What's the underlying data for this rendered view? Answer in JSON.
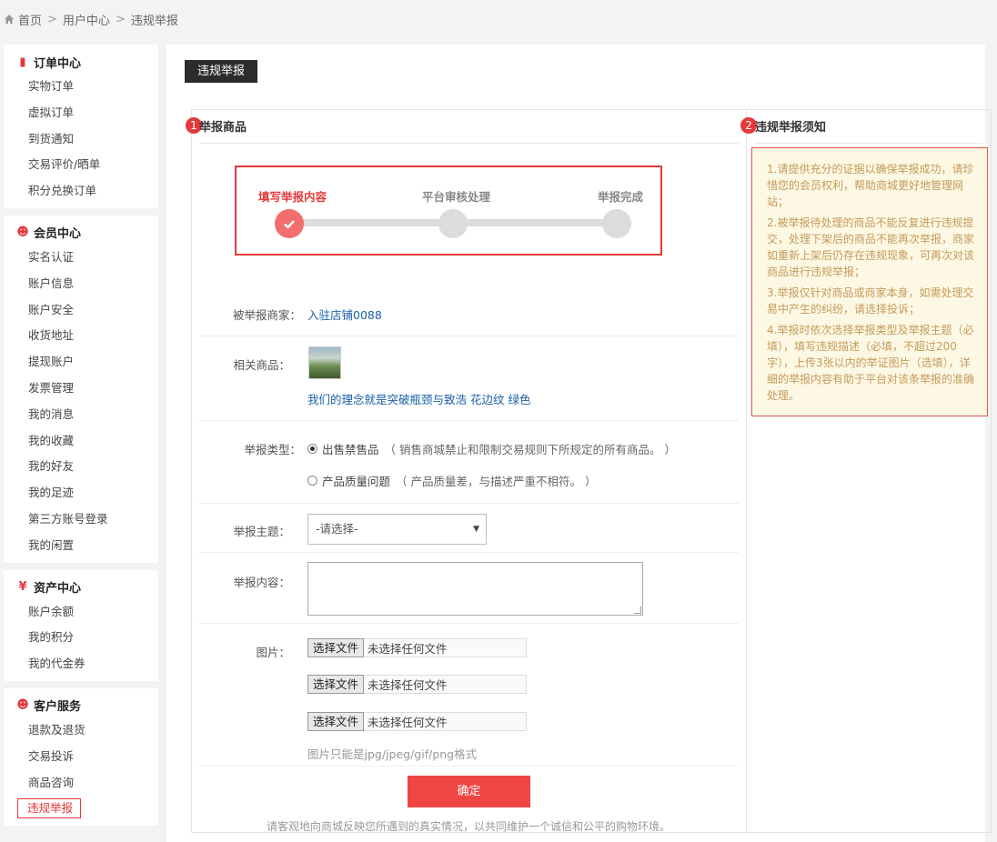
{
  "breadcrumb": {
    "home": "首页",
    "level2": "用户中心",
    "current": "违规举报"
  },
  "sidebar": {
    "groups": [
      {
        "title": "订单中心",
        "icon": "order-icon",
        "items": [
          "实物订单",
          "虚拟订单",
          "到货通知",
          "交易评价/晒单",
          "积分兑换订单"
        ]
      },
      {
        "title": "会员中心",
        "icon": "user-icon",
        "items": [
          "实名认证",
          "账户信息",
          "账户安全",
          "收货地址",
          "提现账户",
          "发票管理",
          "我的消息",
          "我的收藏",
          "我的好友",
          "我的足迹",
          "第三方账号登录",
          "我的闲置"
        ]
      },
      {
        "title": "资产中心",
        "icon": "yen-icon",
        "items": [
          "账户余额",
          "我的积分",
          "我的代金券"
        ]
      },
      {
        "title": "客户服务",
        "icon": "user-icon",
        "items": [
          "退款及退货",
          "交易投诉",
          "商品咨询",
          "违规举报"
        ]
      }
    ],
    "active_item": "违规举报"
  },
  "page_tab": "违规举报",
  "section1": {
    "num": "1",
    "title": "举报商品"
  },
  "section2": {
    "num": "2",
    "title": "违规举报须知"
  },
  "steps": {
    "s1": "填写举报内容",
    "s2": "平台审核处理",
    "s3": "举报完成",
    "current": 1
  },
  "form": {
    "merchant_label": "被举报商家：",
    "merchant_value": "入驻店铺0088",
    "goods_label": "相关商品：",
    "goods_name": "我们的理念就是突破瓶颈与致浩 花边纹 绿色",
    "type_label": "举报类型：",
    "type_opt1": "出售禁售品",
    "type_opt1_note": "（ 销售商城禁止和限制交易规则下所规定的所有商品。 ）",
    "type_opt2": "产品质量问题",
    "type_opt2_note": "（ 产品质量差，与描述严重不相符。 ）",
    "type_selected": 1,
    "subject_label": "举报主题：",
    "subject_value": "-请选择-",
    "content_label": "举报内容：",
    "image_label": "图片：",
    "file_btn": "选择文件",
    "file_text": "未选择任何文件",
    "image_hint": "图片只能是jpg/jpeg/gif/png格式",
    "submit": "确定",
    "footer": "请客观地向商城反映您所遇到的真实情况，以共同维护一个诚信和公平的购物环境。"
  },
  "notice": [
    "1.请提供充分的证据以确保举报成功，请珍惜您的会员权利，帮助商城更好地管理网站；",
    "2.被举报待处理的商品不能反复进行违规提交，处理下架后的商品不能再次举报，商家如重新上架后仍存在违规现象，可再次对该商品进行违规举报；",
    "3.举报仅针对商品或商家本身，如需处理交易中产生的纠纷，请选择投诉；",
    "4.举报时依次选择举报类型及举报主题（必填），填写违规描述（必填，不超过200字），上传3张以内的举证图片（选填），详细的举报内容有助于平台对该条举报的准确处理。"
  ],
  "colors": {
    "accent": "#e4393c",
    "notice_bg": "#fdf8e4",
    "notice_text": "#c49a5a",
    "link": "#1a5fa8"
  }
}
